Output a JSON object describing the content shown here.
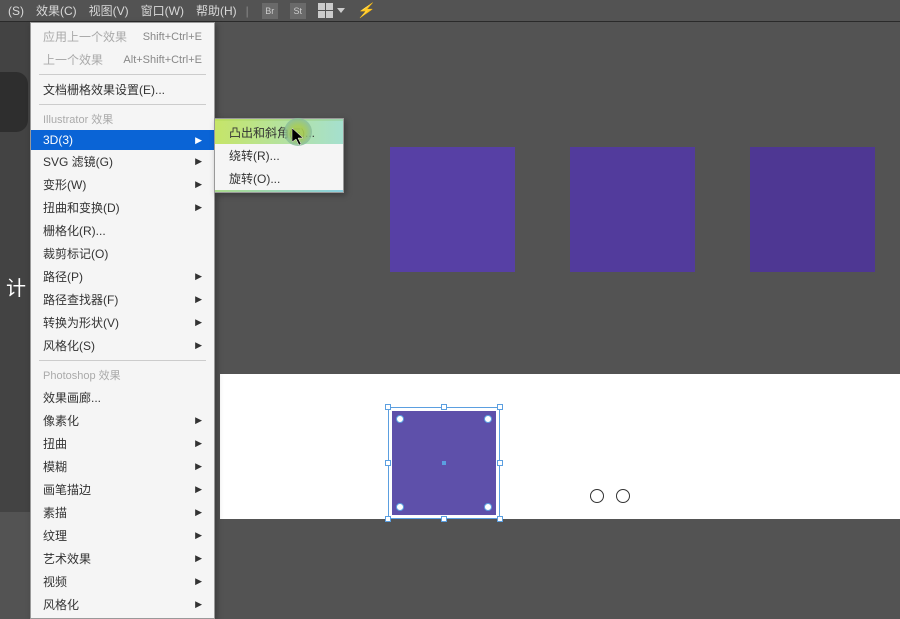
{
  "menubar": {
    "items": [
      "(S)",
      "效果(C)",
      "视图(V)",
      "窗口(W)",
      "帮助(H)"
    ],
    "icons": [
      "Br",
      "St"
    ]
  },
  "dropdown": {
    "recent": [
      {
        "label": "应用上一个效果",
        "shortcut": "Shift+Ctrl+E",
        "disabled": true
      },
      {
        "label": "上一个效果",
        "shortcut": "Alt+Shift+Ctrl+E",
        "disabled": true
      }
    ],
    "doc_raster": "文档栅格效果设置(E)...",
    "section_ai": "Illustrator 效果",
    "ai_items": [
      {
        "label": "3D(3)",
        "arrow": true,
        "highlighted": true
      },
      {
        "label": "SVG 滤镜(G)",
        "arrow": true
      },
      {
        "label": "变形(W)",
        "arrow": true
      },
      {
        "label": "扭曲和变换(D)",
        "arrow": true
      },
      {
        "label": "栅格化(R)..."
      },
      {
        "label": "裁剪标记(O)"
      },
      {
        "label": "路径(P)",
        "arrow": true
      },
      {
        "label": "路径查找器(F)",
        "arrow": true
      },
      {
        "label": "转换为形状(V)",
        "arrow": true
      },
      {
        "label": "风格化(S)",
        "arrow": true
      }
    ],
    "section_ps": "Photoshop 效果",
    "ps_items": [
      {
        "label": "效果画廊..."
      },
      {
        "label": "像素化",
        "arrow": true
      },
      {
        "label": "扭曲",
        "arrow": true
      },
      {
        "label": "模糊",
        "arrow": true
      },
      {
        "label": "画笔描边",
        "arrow": true
      },
      {
        "label": "素描",
        "arrow": true
      },
      {
        "label": "纹理",
        "arrow": true
      },
      {
        "label": "艺术效果",
        "arrow": true
      },
      {
        "label": "视频",
        "arrow": true
      },
      {
        "label": "风格化",
        "arrow": true
      }
    ]
  },
  "submenu": {
    "items": [
      {
        "label": "凸出和斜角(E)...",
        "hover": true
      },
      {
        "label": "绕转(R)..."
      },
      {
        "label": "旋转(O)..."
      }
    ]
  },
  "left_text": "计"
}
